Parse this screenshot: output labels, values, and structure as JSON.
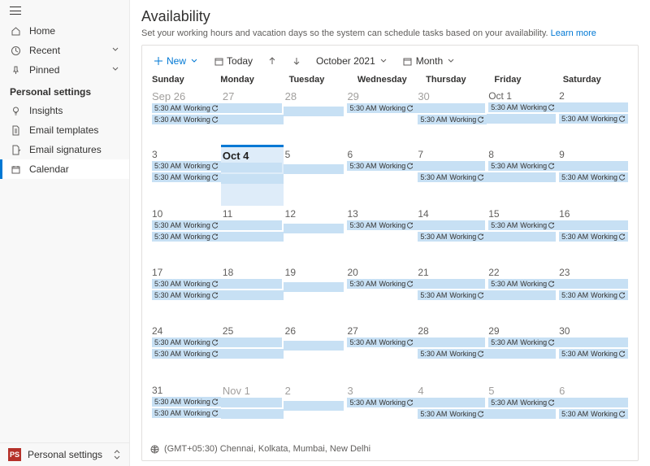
{
  "sidebar": {
    "nav1": [
      {
        "label": "Home",
        "icon": "home"
      },
      {
        "label": "Recent",
        "icon": "clock",
        "chev": true
      },
      {
        "label": "Pinned",
        "icon": "pin",
        "chev": true
      }
    ],
    "sectionTitle": "Personal settings",
    "nav2": [
      {
        "label": "Insights",
        "icon": "bulb"
      },
      {
        "label": "Email templates",
        "icon": "doc"
      },
      {
        "label": "Email signatures",
        "icon": "sig"
      },
      {
        "label": "Calendar",
        "icon": "cal",
        "active": true
      }
    ],
    "footer": {
      "badge": "PS",
      "label": "Personal settings"
    }
  },
  "page": {
    "title": "Availability",
    "subtitle": "Set your working hours and vacation days so the system can schedule tasks based on your availability. ",
    "learnMore": "Learn more"
  },
  "toolbar": {
    "new": "New",
    "today": "Today",
    "period": "October 2021",
    "view": "Month"
  },
  "calendar": {
    "dow": [
      "Sunday",
      "Monday",
      "Tuesday",
      "Wednesday",
      "Thursday",
      "Friday",
      "Saturday"
    ],
    "eventTime": "5:30 AM",
    "eventTitle": "Working",
    "weeks": [
      [
        {
          "label": "Sep 26",
          "other": true,
          "rows": [
            "start",
            "start"
          ]
        },
        {
          "label": "27",
          "other": true,
          "rows": [
            "cont-end",
            "cont"
          ]
        },
        {
          "label": "28",
          "other": true,
          "rows": [
            "spacer",
            "cont-end"
          ]
        },
        {
          "label": "29",
          "other": true,
          "rows": [
            "start",
            "spacer"
          ]
        },
        {
          "label": "30",
          "other": true,
          "rows": [
            "cont-end",
            "start"
          ]
        },
        {
          "label": "Oct 1",
          "rows": [
            "start",
            "cont-end"
          ]
        },
        {
          "label": "2",
          "rows": [
            "cont-end",
            "start-end"
          ]
        }
      ],
      [
        {
          "label": "3",
          "rows": [
            "start",
            "start"
          ]
        },
        {
          "label": "Oct 4",
          "today": true,
          "rows": [
            "cont-end",
            "cont"
          ]
        },
        {
          "label": "5",
          "rows": [
            "spacer",
            "cont-end"
          ]
        },
        {
          "label": "6",
          "rows": [
            "start",
            "spacer"
          ]
        },
        {
          "label": "7",
          "rows": [
            "cont-end",
            "start"
          ]
        },
        {
          "label": "8",
          "rows": [
            "start",
            "cont-end"
          ]
        },
        {
          "label": "9",
          "rows": [
            "cont-end",
            "start-end"
          ]
        }
      ],
      [
        {
          "label": "10",
          "rows": [
            "start",
            "start"
          ]
        },
        {
          "label": "11",
          "rows": [
            "cont-end",
            "cont"
          ]
        },
        {
          "label": "12",
          "rows": [
            "spacer",
            "cont-end"
          ]
        },
        {
          "label": "13",
          "rows": [
            "start",
            "spacer"
          ]
        },
        {
          "label": "14",
          "rows": [
            "cont-end",
            "start"
          ]
        },
        {
          "label": "15",
          "rows": [
            "start",
            "cont-end"
          ]
        },
        {
          "label": "16",
          "rows": [
            "cont-end",
            "start-end"
          ]
        }
      ],
      [
        {
          "label": "17",
          "rows": [
            "start",
            "start"
          ]
        },
        {
          "label": "18",
          "rows": [
            "cont-end",
            "cont"
          ]
        },
        {
          "label": "19",
          "rows": [
            "spacer",
            "cont-end"
          ]
        },
        {
          "label": "20",
          "rows": [
            "start",
            "spacer"
          ]
        },
        {
          "label": "21",
          "rows": [
            "cont-end",
            "start"
          ]
        },
        {
          "label": "22",
          "rows": [
            "start",
            "cont-end"
          ]
        },
        {
          "label": "23",
          "rows": [
            "cont-end",
            "start-end"
          ]
        }
      ],
      [
        {
          "label": "24",
          "rows": [
            "start",
            "start"
          ]
        },
        {
          "label": "25",
          "rows": [
            "cont-end",
            "cont"
          ]
        },
        {
          "label": "26",
          "rows": [
            "spacer",
            "cont-end"
          ]
        },
        {
          "label": "27",
          "rows": [
            "start",
            "spacer"
          ]
        },
        {
          "label": "28",
          "rows": [
            "cont-end",
            "start"
          ]
        },
        {
          "label": "29",
          "rows": [
            "start",
            "cont-end"
          ]
        },
        {
          "label": "30",
          "rows": [
            "cont-end",
            "start-end"
          ]
        }
      ],
      [
        {
          "label": "31",
          "rows": [
            "start",
            "start"
          ]
        },
        {
          "label": "Nov 1",
          "other": true,
          "rows": [
            "cont-end",
            "cont"
          ]
        },
        {
          "label": "2",
          "other": true,
          "rows": [
            "spacer",
            "cont-end"
          ]
        },
        {
          "label": "3",
          "other": true,
          "rows": [
            "start",
            "spacer"
          ]
        },
        {
          "label": "4",
          "other": true,
          "rows": [
            "cont-end",
            "start"
          ]
        },
        {
          "label": "5",
          "other": true,
          "rows": [
            "start",
            "cont-end"
          ]
        },
        {
          "label": "6",
          "other": true,
          "rows": [
            "cont-end",
            "start-end"
          ]
        }
      ]
    ]
  },
  "timezone": "(GMT+05:30) Chennai, Kolkata, Mumbai, New Delhi"
}
